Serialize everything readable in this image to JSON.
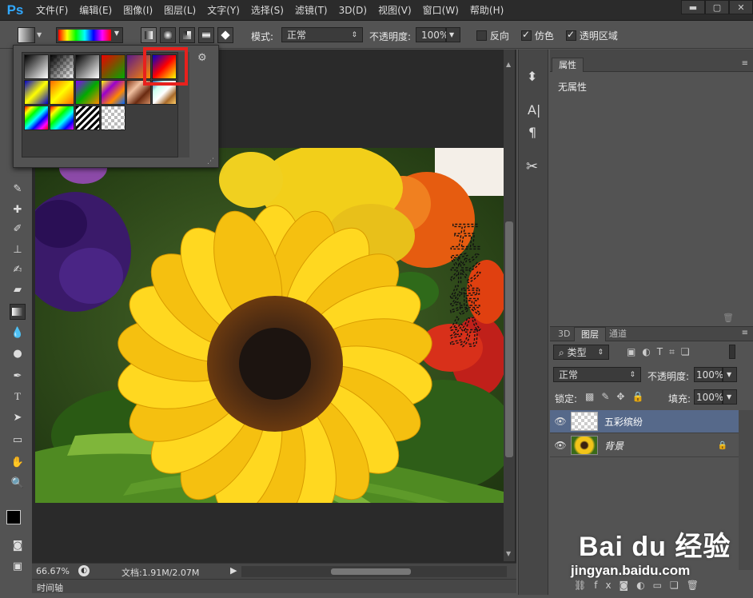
{
  "app": {
    "logo": "Ps",
    "accent": "#31a8ff"
  },
  "menu": [
    "文件(F)",
    "编辑(E)",
    "图像(I)",
    "图层(L)",
    "文字(Y)",
    "选择(S)",
    "滤镜(T)",
    "3D(D)",
    "视图(V)",
    "窗口(W)",
    "帮助(H)"
  ],
  "options": {
    "mode_label": "模式:",
    "mode_value": "正常",
    "opacity_label": "不透明度:",
    "opacity_value": "100%",
    "reverse_label": "反向",
    "dither_label": "仿色",
    "transparency_label": "透明区域",
    "reverse_checked": false,
    "dither_checked": true,
    "transparency_checked": true
  },
  "canvas_text": "五彩缤纷",
  "status": {
    "zoom": "66.67%",
    "doc": "文档:1.91M/2.07M"
  },
  "timeline_tab": "时间轴",
  "properties": {
    "tab": "属性",
    "empty": "无属性"
  },
  "layers": {
    "tabs": [
      "3D",
      "图层",
      "通道"
    ],
    "filter_label": "类型",
    "blend_mode": "正常",
    "opacity_label": "不透明度:",
    "opacity_value": "100%",
    "lock_label": "锁定:",
    "fill_label": "填充:",
    "fill_value": "100%",
    "items": [
      {
        "name": "五彩缤纷",
        "selected": true
      },
      {
        "name": "背景",
        "selected": false
      }
    ]
  },
  "gradient_presets": [
    "foreground-to-background",
    "foreground-to-transparent",
    "black-white",
    "red-green",
    "violet-orange",
    "blue-red-yellow",
    "blue-yellow-blue",
    "orange-yellow-orange",
    "violet-green-orange",
    "yellow-violet-orange-blue",
    "copper",
    "chrome",
    "spectrum",
    "transparent-rainbow",
    "transparent-stripes",
    "checker-transparent"
  ],
  "highlight_color": "#e8211d",
  "watermark": {
    "brand": "Bai du 经验",
    "url": "jingyan.baidu.com"
  }
}
